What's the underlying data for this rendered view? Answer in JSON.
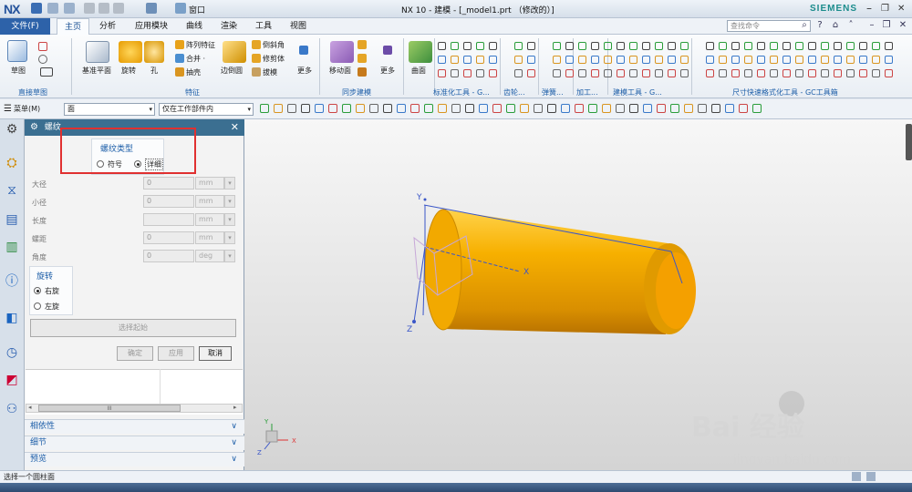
{
  "titlebar": {
    "logo": "NX",
    "window_menu": "窗口",
    "title": "NX 10 - 建模 - [_model1.prt （修改的）]",
    "brand": "SIEMENS",
    "min": "–",
    "restore": "❐",
    "close": "✕"
  },
  "menubar": {
    "file": "文件(F)",
    "tabs": [
      "主页",
      "分析",
      "应用模块",
      "曲线",
      "渲染",
      "工具",
      "视图"
    ],
    "search_placeholder": "查找命令"
  },
  "ribbon": {
    "sketch": "草图",
    "datum_plane": "基准平面",
    "revolve": "旋转",
    "hole": "孔",
    "pattern_feature": "阵列特征",
    "unite": "合并 ·",
    "shell": "抽壳",
    "edge_blend": "边倒圆",
    "chamfer": "倒斜角",
    "trim_body": "修剪体",
    "draft": "拔模",
    "more1": "更多",
    "move_face": "移动面",
    "more2": "更多",
    "surface": "曲面",
    "groups": [
      "直接草图",
      "特征",
      "同步建模",
      "标准化工具 - G...",
      "齿轮...",
      "弹簧...",
      "加工...",
      "建模工具 - G...",
      "尺寸快速格式化工具 - GC工具箱"
    ]
  },
  "toolbar2": {
    "menu": "菜单(M)",
    "filter": "面",
    "scope": "仅在工作部件内"
  },
  "dialog": {
    "title": "螺纹",
    "thread_type_label": "螺纹类型",
    "option_symbolic": "符号",
    "option_detailed": "详细",
    "fields": [
      {
        "label": "大径",
        "value": "0",
        "unit": "mm"
      },
      {
        "label": "小径",
        "value": "0",
        "unit": "mm"
      },
      {
        "label": "长度",
        "value": "",
        "unit": "mm"
      },
      {
        "label": "螺距",
        "value": "0",
        "unit": "mm"
      },
      {
        "label": "角度",
        "value": "0",
        "unit": "deg"
      }
    ],
    "rotation_label": "旋转",
    "right_hand": "右旋",
    "left_hand": "左旋",
    "select_start": "选择起始",
    "ok": "确定",
    "apply": "应用",
    "cancel": "取消",
    "scroll_mark": "III",
    "sections": [
      "相依性",
      "细节",
      "预览"
    ]
  },
  "viewport": {
    "axis_x": "X",
    "axis_y": "Y",
    "axis_z": "Z",
    "cylinder_color": "#f0a800",
    "watermark_main": "Bai  经验",
    "watermark_sub": "jingyan.baidu.com"
  },
  "statusbar": {
    "prompt": "选择一个圆柱面"
  }
}
